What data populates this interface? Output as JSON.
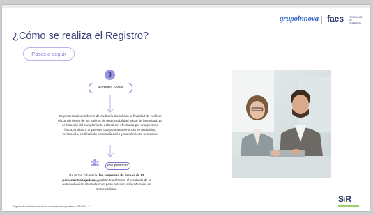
{
  "header": {
    "logo_grupo": "grupoinnova",
    "logo_faes": "faes",
    "logo_faes_sub": "FUNDACIÓN DE ESTUDIOS"
  },
  "title": "¿Cómo se realiza el Registro?",
  "steps_pill": "Pasos a seguir",
  "step": {
    "number": "3",
    "label": "Auditoría Social"
  },
  "paragraph_1": "Se presentará un Informe de Auditoría Social con la finalidad de verificar el cumplimiento de los valores de responsabilidad social de la entidad. La verificación del cumplimiento deberá ser efectuada por una persona física, entidad u organismo que posea experiencia en auditorías, verificación, certificación o normalización y cumplimiento normativo.",
  "small_badge": "<50 personas",
  "paragraph_2": {
    "lead": "De forma voluntaria, ",
    "bold": "las empresas de menos de 50 personas trabajadoras,",
    "rest": " podrán transformar el resultado de la autoevaluación obtenida en el paso anterior, en la Memoria de Sostenibilidad."
  },
  "footer": "Registro de entidades colectoras: socialmente responsables / PÁGINA - 3",
  "sir_logo": {
    "s": "S",
    "i": "i",
    "r": "R"
  },
  "colors": {
    "accent": "#9a96e0",
    "title": "#3a3f7a",
    "pill_border": "#b9b6ea",
    "brand_blue": "#2d63c8",
    "brand_dark": "#2b2f6e",
    "sir_green": "#7fbf3a"
  }
}
